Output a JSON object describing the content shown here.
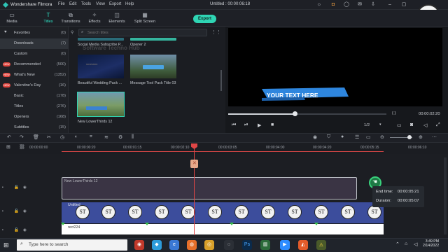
{
  "app": {
    "name": "Wondershare Filmora",
    "menu": [
      "File",
      "Edit",
      "Tools",
      "View",
      "Export",
      "Help"
    ],
    "project_title": "Untitled : 00:00:06:18"
  },
  "toolbar": {
    "tabs": [
      {
        "label": "Media",
        "icon": "media-icon"
      },
      {
        "label": "Titles",
        "icon": "titles-icon"
      },
      {
        "label": "Transitions",
        "icon": "transitions-icon"
      },
      {
        "label": "Effects",
        "icon": "effects-icon"
      },
      {
        "label": "Elements",
        "icon": "elements-icon"
      },
      {
        "label": "Split Screen",
        "icon": "split-screen-icon"
      }
    ],
    "active": "Titles",
    "export_label": "Export"
  },
  "sidebar": {
    "items": [
      {
        "label": "Favorites",
        "count": "(0)"
      },
      {
        "label": "Downloads",
        "count": "(7)",
        "selected": true
      },
      {
        "label": "Custom",
        "count": "(0)"
      },
      {
        "label": "Recommended",
        "count": "(500)",
        "badge": "NEW"
      },
      {
        "label": "What's New",
        "count": "(1352)",
        "badge": "NEW"
      },
      {
        "label": "Valentine's Day",
        "count": "(16)",
        "badge": "NEW"
      },
      {
        "label": "Basic",
        "count": "(178)"
      },
      {
        "label": "Titles",
        "count": "(276)"
      },
      {
        "label": "Openers",
        "count": "(168)"
      },
      {
        "label": "Subtitles",
        "count": "(15)"
      }
    ]
  },
  "library": {
    "search_placeholder": "Search titles",
    "watermark": "Software Techno Hub",
    "items": [
      {
        "label": "Social Media Subscribe P..."
      },
      {
        "label": "Opener 2"
      },
      {
        "label": "Beautiful Wedding Pack ..."
      },
      {
        "label": "Message Tool Pack Title 03"
      },
      {
        "label": "New LowerThirds 12"
      }
    ]
  },
  "preview": {
    "overlay_text": "YOUR TEXT HERE",
    "time_left": "{ }",
    "current_time": "00:00:02:20",
    "page": "1/2",
    "progress": 0.42,
    "logo_text": "ST"
  },
  "ruler": {
    "labels": [
      "00:00:00:00",
      "00:00:00:20",
      "00:00:01:15",
      "00:00:02:10",
      "00:00:03:05",
      "00:00:04:00",
      "00:00:04:20",
      "00:00:05:15",
      "00:00:06:10"
    ]
  },
  "tracks": {
    "clip1_label": "New LowerThirds 12",
    "clip2_label": "Untitled",
    "clip3_label": "rect224",
    "st_text": "ST"
  },
  "tooltip": {
    "end_label": "End time:",
    "end_value": "00:00:05:21",
    "dur_label": "Duraion:",
    "dur_value": "00:00:05:07"
  },
  "taskbar": {
    "search_placeholder": "Type here to search",
    "time": "3:49 PM",
    "date": "2/14/2022"
  }
}
